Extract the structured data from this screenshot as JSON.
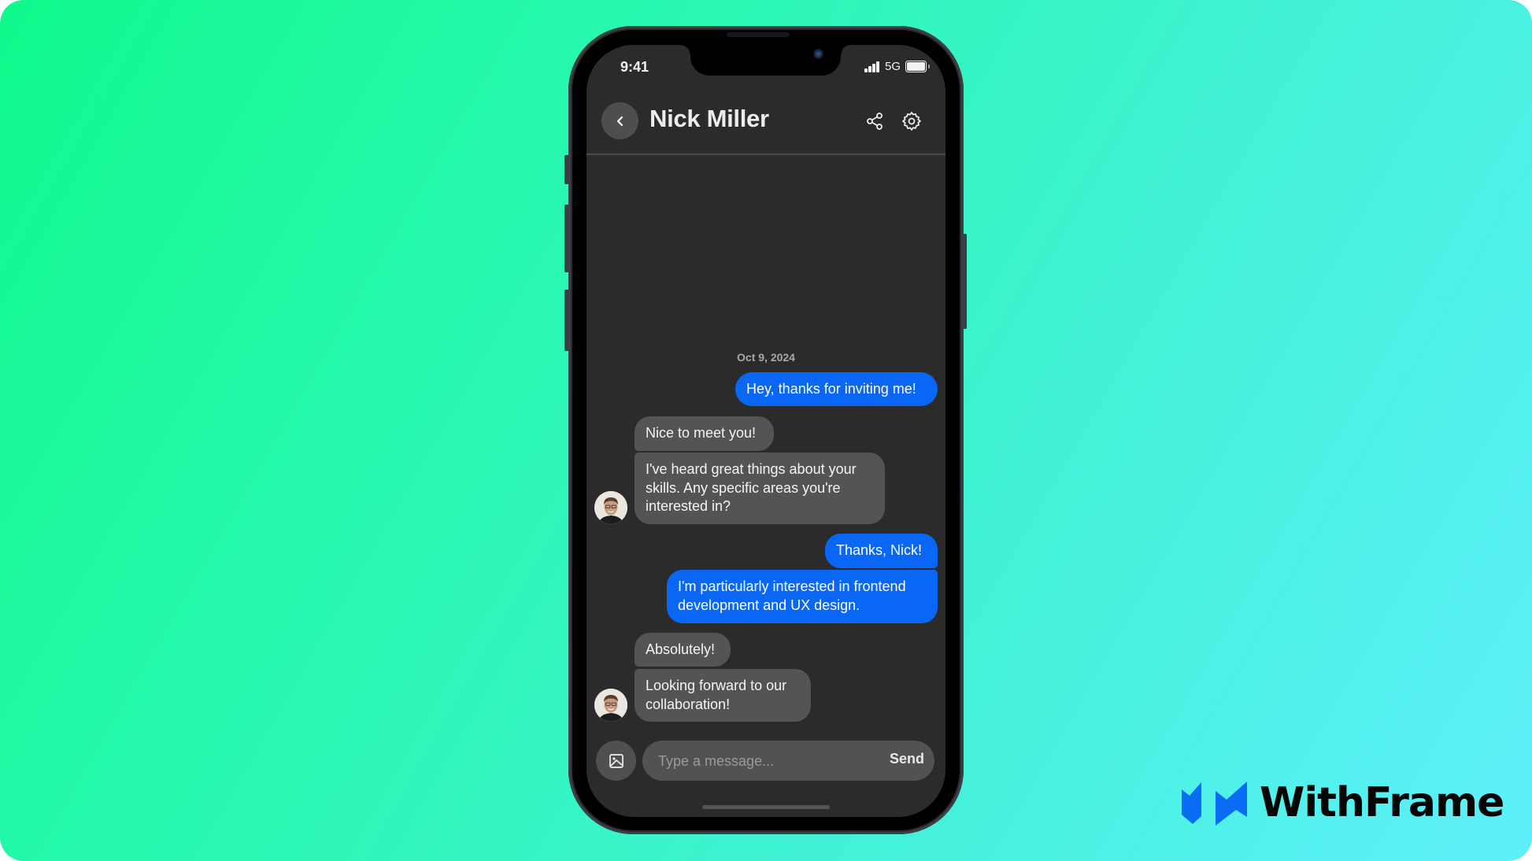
{
  "status_bar": {
    "time": "9:41",
    "network": "5G",
    "signal_icon": "cellular-signal-icon",
    "battery_icon": "battery-full-icon"
  },
  "header": {
    "back_icon": "chevron-left-icon",
    "title": "Nick Miller",
    "share_icon": "share-icon",
    "settings_icon": "gear-icon"
  },
  "conversation": {
    "date": "Oct 9, 2024",
    "messages": [
      {
        "direction": "outgoing",
        "text": "Hey, thanks for inviting me!"
      },
      {
        "direction": "incoming",
        "text": "Nice to meet you!"
      },
      {
        "direction": "incoming",
        "text": "I've heard great things about your skills. Any specific areas you're interested in?"
      },
      {
        "direction": "outgoing",
        "text": "Thanks, Nick!"
      },
      {
        "direction": "outgoing",
        "text": "I'm particularly interested in frontend development and UX design."
      },
      {
        "direction": "incoming",
        "text": "Absolutely!"
      },
      {
        "direction": "incoming",
        "text": "Looking forward to our collaboration!"
      }
    ],
    "avatar_alt": "Nick Miller avatar"
  },
  "composer": {
    "attach_icon": "image-icon",
    "placeholder": "Type a message...",
    "value": "",
    "send_label": "Send"
  },
  "brand": {
    "name": "WithFrame",
    "logo_icon": "withframe-logo-icon",
    "accent": "#0a6cf5"
  },
  "colors": {
    "outgoing_bubble": "#0a67f6",
    "incoming_bubble": "#545454",
    "screen_background": "#2b2b2b",
    "page_gradient_start": "#10f98c",
    "page_gradient_end": "#5ef0fb"
  }
}
